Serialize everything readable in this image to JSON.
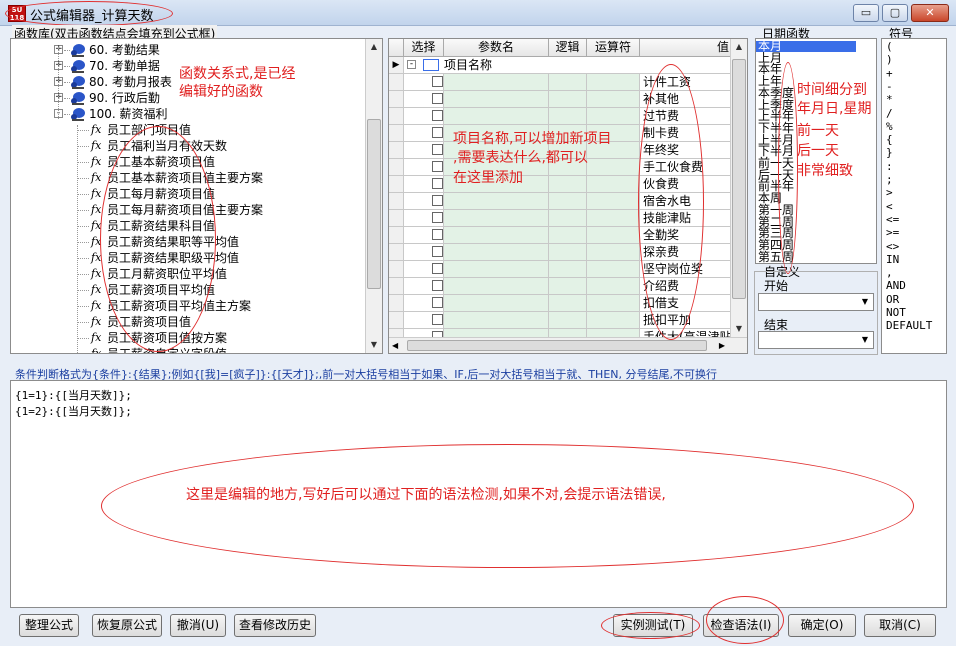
{
  "window": {
    "title": "公式编辑器_计算天数",
    "app_icon_text": "SU 118",
    "min": "▭",
    "max": "▢",
    "close": "✕"
  },
  "function_library": {
    "label": "函数库(双击函数结点会填充到公式框)",
    "tree": [
      {
        "label": "60. 考勤结果",
        "kind": "folder",
        "expander": "+"
      },
      {
        "label": "70. 考勤单据",
        "kind": "folder",
        "expander": "+"
      },
      {
        "label": "80. 考勤月报表",
        "kind": "folder",
        "expander": "+"
      },
      {
        "label": "90. 行政后勤",
        "kind": "folder",
        "expander": "+"
      },
      {
        "label": "100. 薪资福利",
        "kind": "folder",
        "expander": "-"
      },
      {
        "label": "员工部门项目值",
        "kind": "fx"
      },
      {
        "label": "员工福利当月有效天数",
        "kind": "fx"
      },
      {
        "label": "员工基本薪资项目值",
        "kind": "fx"
      },
      {
        "label": "员工基本薪资项目值主要方案",
        "kind": "fx"
      },
      {
        "label": "员工每月薪资项目值",
        "kind": "fx"
      },
      {
        "label": "员工每月薪资项目值主要方案",
        "kind": "fx"
      },
      {
        "label": "员工薪资结果科目值",
        "kind": "fx"
      },
      {
        "label": "员工薪资结果职等平均值",
        "kind": "fx"
      },
      {
        "label": "员工薪资结果职级平均值",
        "kind": "fx"
      },
      {
        "label": "员工月薪资职位平均值",
        "kind": "fx"
      },
      {
        "label": "员工薪资项目平均值",
        "kind": "fx"
      },
      {
        "label": "员工薪资项目平均值主方案",
        "kind": "fx"
      },
      {
        "label": "员工薪资项目值",
        "kind": "fx"
      },
      {
        "label": "员工薪资项目值按方案",
        "kind": "fx"
      },
      {
        "label": "员工薪资自定义字段值",
        "kind": "fx"
      }
    ]
  },
  "item_grid": {
    "columns": [
      "选择",
      "参数名",
      "逻辑",
      "运算符",
      "值"
    ],
    "root_label": "项目名称",
    "root_expander": "-",
    "values": [
      "计件工资",
      "补其他",
      "过节费",
      "制卡费",
      "年终奖",
      "手工伙食费",
      "伙食费",
      "宿舍水电",
      "技能津贴",
      "全勤奖",
      "探亲费",
      "坚守岗位奖",
      "介绍费",
      "扣借支",
      "抵扣平加",
      "手件大(高温津贴)"
    ]
  },
  "date_functions": {
    "label": "日期函数",
    "items": [
      "本月",
      "上月",
      "本年",
      "上年",
      "本季度",
      "上季度",
      "上半年",
      "下半年",
      "上半月",
      "下半月",
      "前一天",
      "后一天",
      "前半年",
      "本周",
      "第一周",
      "第二周",
      "第三周",
      "第四周",
      "第五周"
    ],
    "custom_label": "自定义",
    "start_label": "开始",
    "end_label": "结束"
  },
  "symbols": {
    "label": "符号",
    "items": [
      "(",
      ")",
      "+",
      "-",
      "*",
      "/",
      "%",
      "{",
      "}",
      ":",
      ";",
      ">",
      "<",
      "<=",
      ">=",
      "<>",
      "IN",
      ",",
      "AND",
      "OR",
      "NOT",
      "DEFAULT"
    ]
  },
  "editor": {
    "hint": "条件判断格式为{条件}:{结果};例如{[我]=[疯子]}:{[天才]};,前一对大括号相当于如果、IF,后一对大括号相当于就、THEN, 分号结尾,不可换行",
    "lines": [
      "{1=1}:{[当月天数]};",
      "{1=2}:{[当月天数]};"
    ]
  },
  "buttons": {
    "tidy": "整理公式",
    "restore": "恢复原公式",
    "undo": "撤消(U)",
    "history": "查看修改历史",
    "test": "实例测试(T)",
    "check": "检查语法(I)",
    "ok": "确定(O)",
    "cancel": "取消(C)"
  },
  "annotations": {
    "functions_note_1": "函数关系式,是已经",
    "functions_note_2": "编辑好的函数",
    "items_note_1": "项目名称,可以增加新项目",
    "items_note_2": ",需要表达什么,都可以",
    "items_note_3": "在这里添加",
    "date_note_1": "时间细分到",
    "date_note_2": "年月日,星期",
    "date_note_3": "前一天",
    "date_note_4": "后一天",
    "date_note_5": "非常细致",
    "editor_note": "这里是编辑的地方,写好后可以通过下面的语法检测,如果不对,会提示语法错误,"
  },
  "colors": {
    "annotation": "#e02020",
    "hint": "#1a3ea0",
    "selection": "#3a6ee8",
    "grid_green": "#e3f2e6"
  }
}
